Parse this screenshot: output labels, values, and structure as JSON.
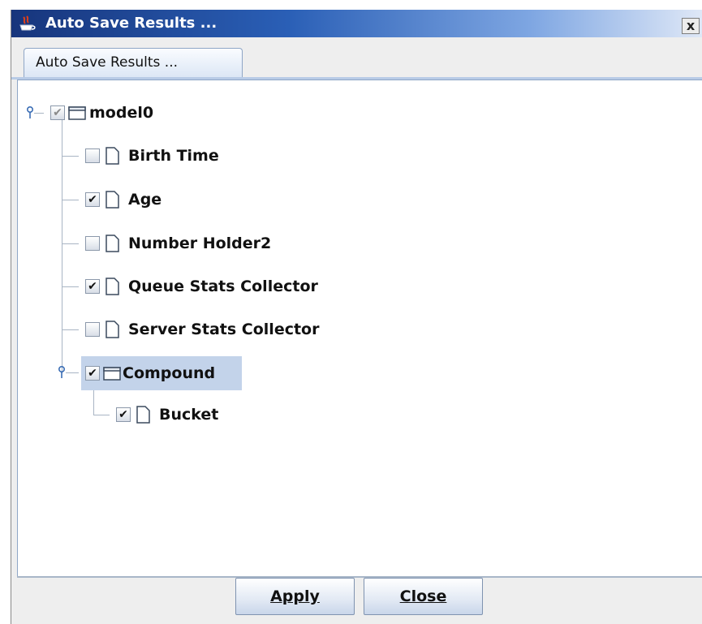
{
  "window": {
    "title": "Auto Save Results ...",
    "close_label": "x"
  },
  "tab": {
    "label": "Auto Save Results ..."
  },
  "tree": {
    "root": {
      "label": "model0",
      "checked": true,
      "expanded": true,
      "icon": "folder-icon"
    },
    "items": [
      {
        "label": "Birth Time",
        "checked": false,
        "icon": "file-icon"
      },
      {
        "label": "Age",
        "checked": true,
        "icon": "file-icon"
      },
      {
        "label": "Number Holder2",
        "checked": false,
        "icon": "file-icon"
      },
      {
        "label": "Queue Stats Collector",
        "checked": true,
        "icon": "file-icon"
      },
      {
        "label": "Server Stats Collector",
        "checked": false,
        "icon": "file-icon"
      },
      {
        "label": "Compound",
        "checked": true,
        "expanded": true,
        "selected": true,
        "icon": "folder-icon"
      },
      {
        "label": "Bucket",
        "checked": true,
        "icon": "file-icon"
      }
    ],
    "check_glyph": "✔"
  },
  "buttons": {
    "apply_label": "Apply",
    "close_label": "Close"
  },
  "colors": {
    "titlebar_start": "#17357c",
    "selection": "#c3d3ea",
    "tab_border": "#8fa6c6"
  }
}
